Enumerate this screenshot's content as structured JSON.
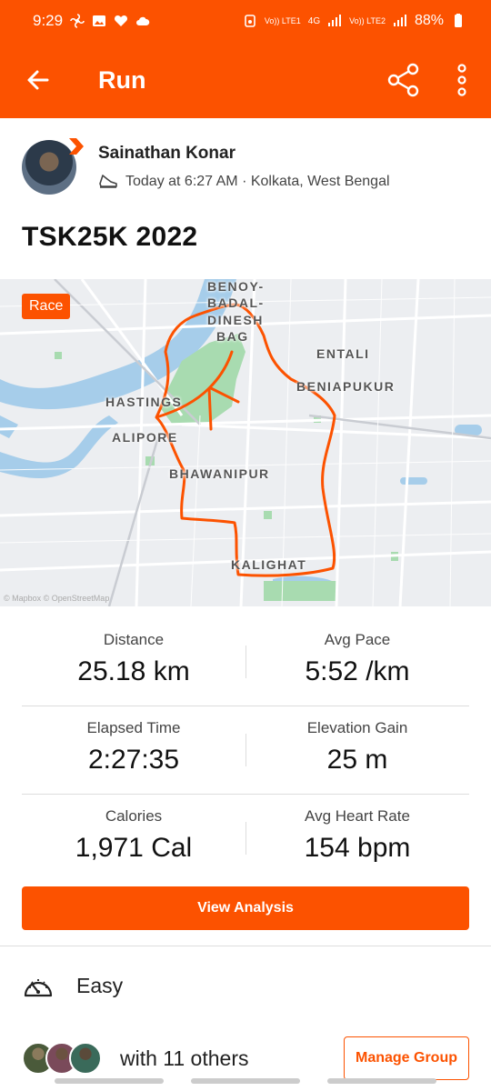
{
  "status_bar": {
    "time": "9:29",
    "battery": "88%",
    "sim1": "Vo)) LTE1",
    "sim2": "Vo)) LTE2",
    "network": "4G"
  },
  "app_bar": {
    "title": "Run"
  },
  "athlete": {
    "name": "Sainathan Konar",
    "meta": "Today at 6:27 AM · Kolkata, West Bengal"
  },
  "activity": {
    "title": "TSK25K 2022",
    "badge": "Race"
  },
  "map": {
    "labels": [
      "BENOY-",
      "BADAL-",
      "DINESH",
      "BAG",
      "ENTALI",
      "BENIAPUKUR",
      "HASTINGS",
      "ALIPORE",
      "BHAWANIPUR",
      "KALIGHAT"
    ],
    "attribution": "© Mapbox © OpenStreetMap"
  },
  "stats": [
    {
      "label": "Distance",
      "value": "25.18 km"
    },
    {
      "label": "Avg Pace",
      "value": "5:52 /km"
    },
    {
      "label": "Elapsed Time",
      "value": "2:27:35"
    },
    {
      "label": "Elevation Gain",
      "value": "25 m"
    },
    {
      "label": "Calories",
      "value": "1,971 Cal"
    },
    {
      "label": "Avg Heart Rate",
      "value": "154 bpm"
    }
  ],
  "buttons": {
    "view_analysis": "View Analysis",
    "manage_group": "Manage Group"
  },
  "effort": {
    "label": "Easy"
  },
  "group": {
    "label": "with 11 others"
  },
  "colors": {
    "brand": "#fc5200"
  }
}
